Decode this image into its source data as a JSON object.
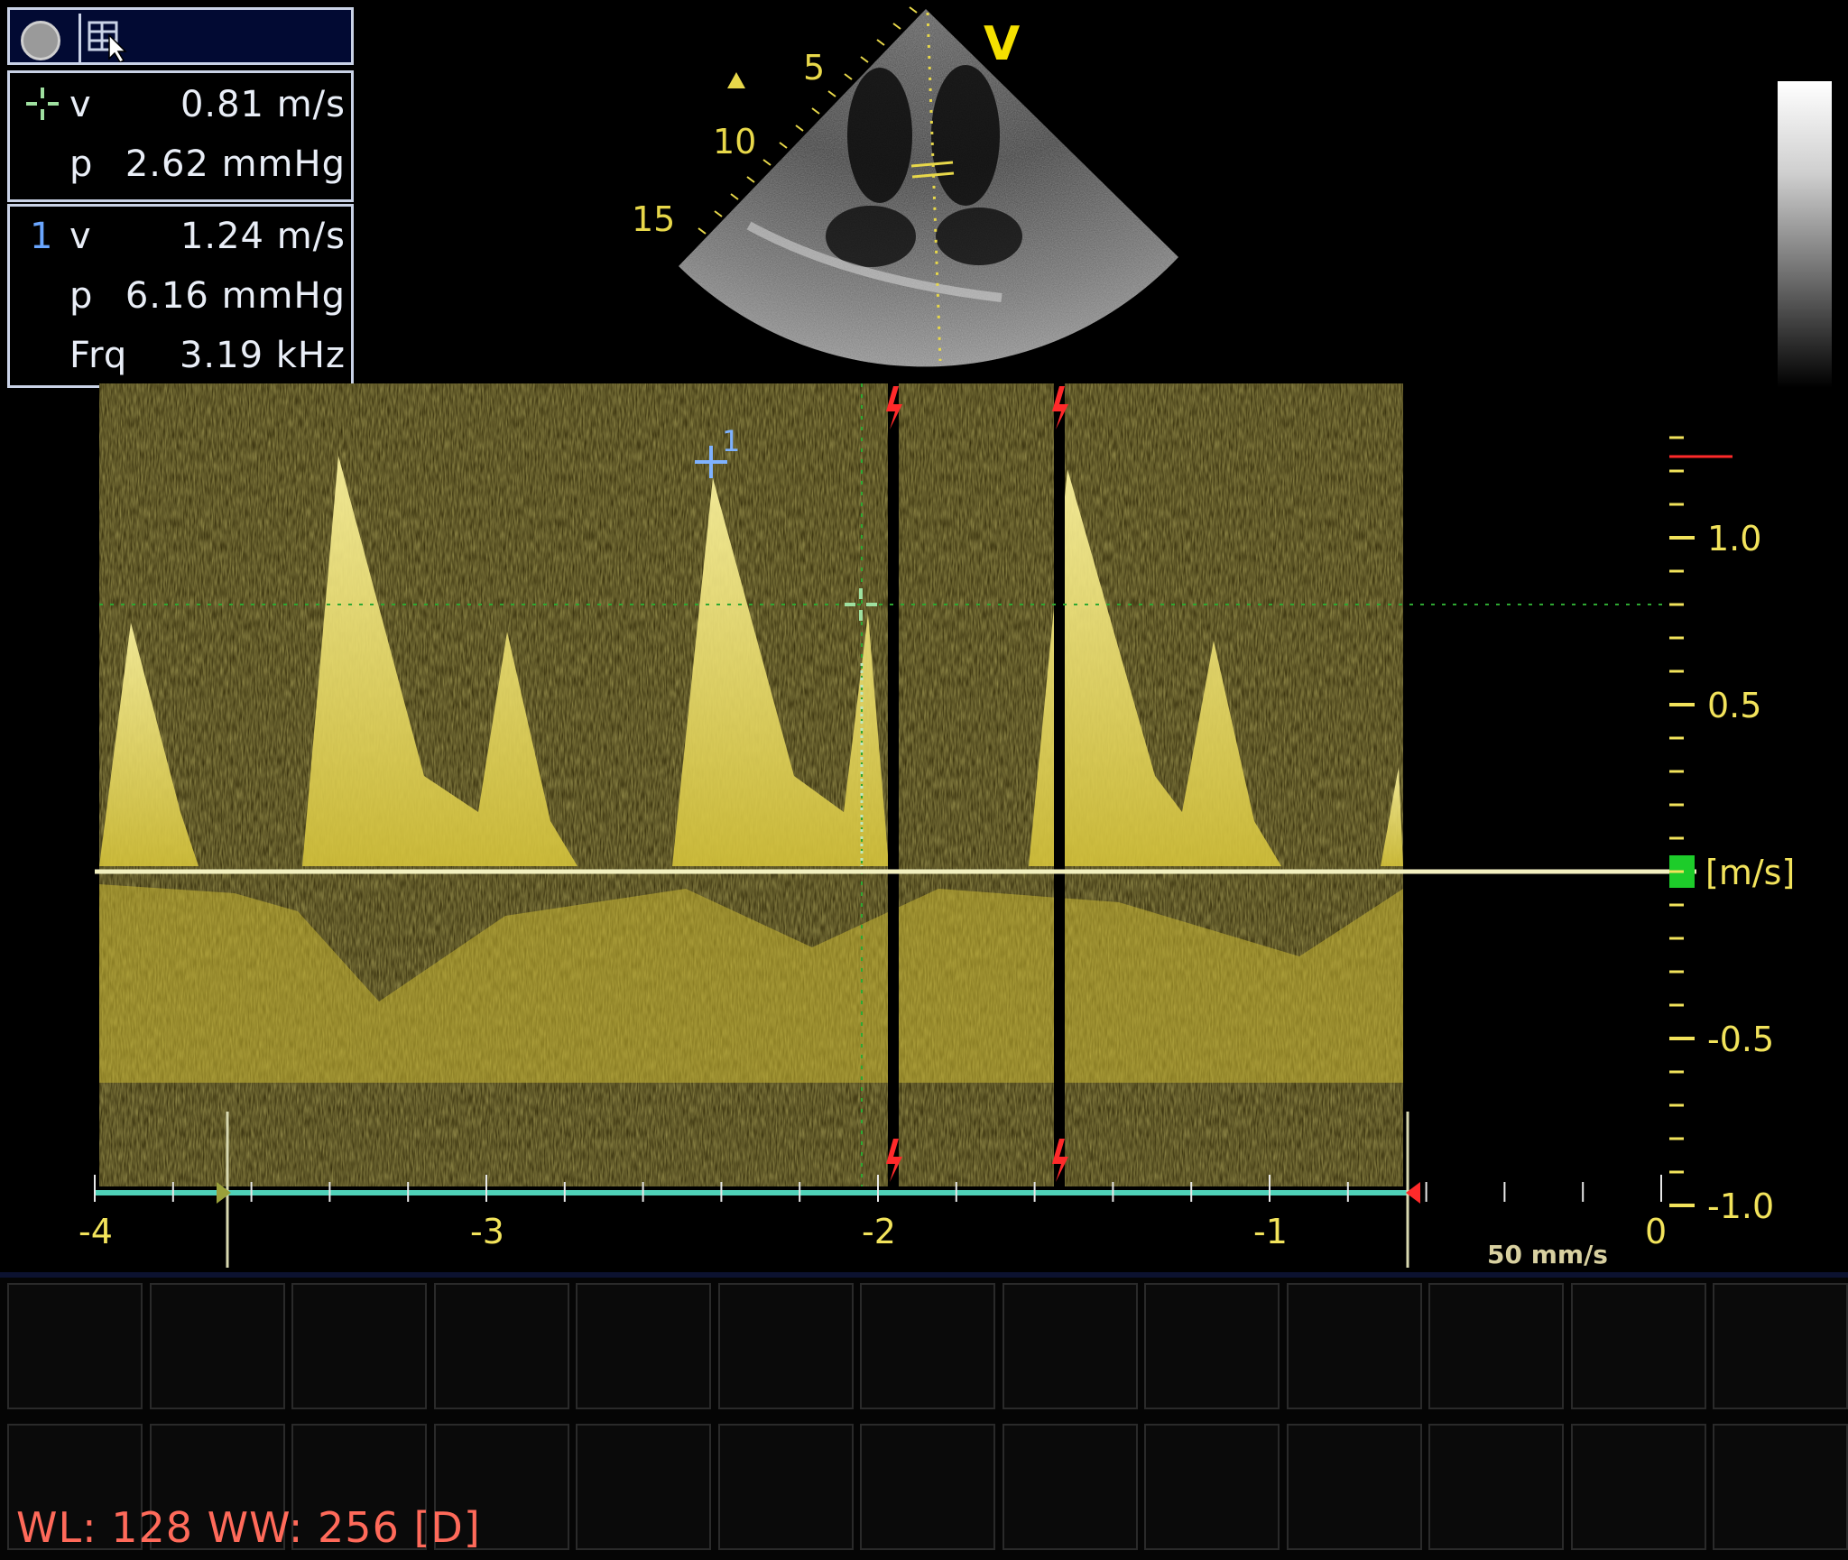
{
  "measurement_panel": {
    "cursor_velocity": {
      "label": "v",
      "value": "0.81 m/s"
    },
    "cursor_pressure": {
      "label": "p",
      "value": "2.62 mmHg"
    },
    "marker1": {
      "index": "1",
      "velocity": {
        "label": "v",
        "value": "1.24 m/s"
      },
      "pressure": {
        "label": "p",
        "value": "6.16 mmHg"
      },
      "frequency": {
        "label": "Frq",
        "value": "3.19 kHz"
      }
    }
  },
  "sector_view": {
    "orientation_marker": "V",
    "depth_labels": [
      "5",
      "10",
      "15"
    ]
  },
  "velocity_scale": {
    "unit": "[m/s]",
    "tick_labels": [
      "1.0",
      "0.5",
      "-0.5",
      "-1.0"
    ],
    "tick_values": [
      1.0,
      0.5,
      -0.5,
      -1.0
    ],
    "range": [
      -1.0,
      1.25
    ]
  },
  "time_axis": {
    "tick_labels": [
      "-4",
      "-3",
      "-2",
      "-1",
      "0"
    ],
    "tick_values": [
      -4,
      -3,
      -2,
      -1,
      0
    ],
    "sweep_speed": "50 mm/s"
  },
  "cursor_marker": {
    "label": "1"
  },
  "window_level": "WL: 128 WW: 256 [D]",
  "colors": {
    "doppler": "#e8d84a",
    "scale": "#f2e35b",
    "cursor": "#9fe0a0",
    "marker": "#6aa6ff",
    "baseline_axis": "#4fd1b8",
    "trigger": "#ff2a2a",
    "window_level": "#ff6a5a"
  }
}
